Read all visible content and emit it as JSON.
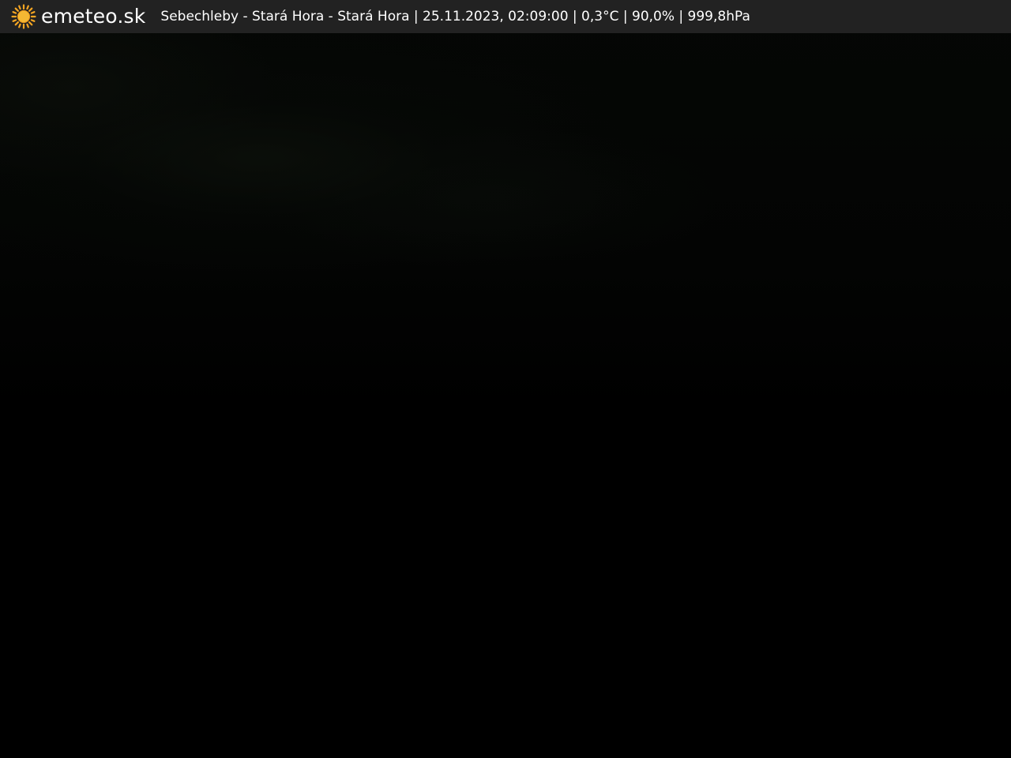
{
  "brand": {
    "name": "emeteo.sk",
    "icon": "sun-icon",
    "icon_color": "#f5a623"
  },
  "caption": {
    "text": "Sebechleby - Stará Hora - Stará Hora | 25.11.2023, 02:09:00 | 0,3°C | 90,0% | 999,8hPa"
  },
  "colors": {
    "bar_background": "#222222",
    "image_background": "#000000",
    "text": "#ffffff"
  }
}
